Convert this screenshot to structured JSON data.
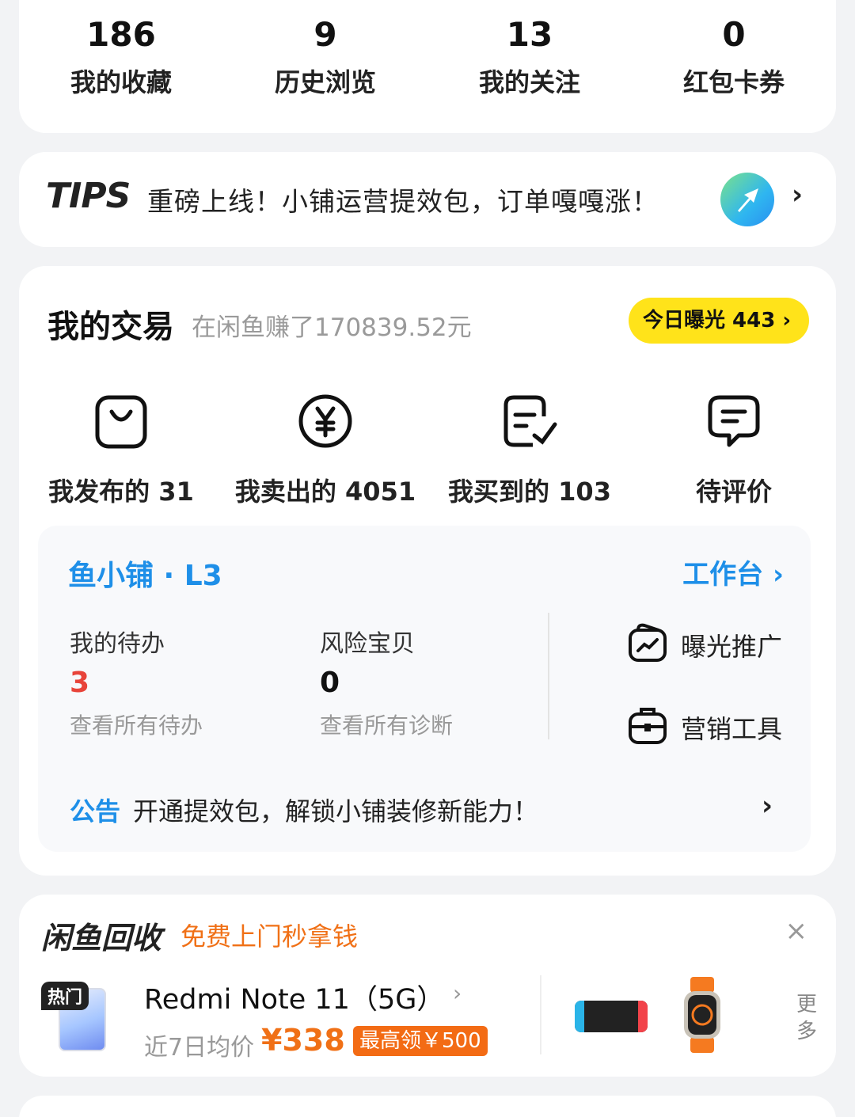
{
  "stats": [
    {
      "value": "186",
      "label": "我的收藏"
    },
    {
      "value": "9",
      "label": "历史浏览"
    },
    {
      "value": "13",
      "label": "我的关注"
    },
    {
      "value": "0",
      "label": "红包卡券"
    }
  ],
  "tips": {
    "logo": "TIPS",
    "text": "重磅上线！小铺运营提效包，订单嘎嘎涨！",
    "chevron": "›"
  },
  "trade": {
    "title": "我的交易",
    "earned": "在闲鱼赚了170839.52元",
    "exposure": "今日曝光 443 ›",
    "entries": [
      {
        "icon": "bag-icon",
        "label": "我发布的 31"
      },
      {
        "icon": "yen-circle-icon",
        "label": "我卖出的 4051"
      },
      {
        "icon": "checked-list-icon",
        "label": "我买到的 103"
      },
      {
        "icon": "comment-icon",
        "label": "待评价"
      }
    ],
    "shop": {
      "name": "鱼小铺 · L3",
      "workbench": "工作台 ›",
      "todo": {
        "title": "我的待办",
        "value": "3",
        "link": "查看所有待办"
      },
      "risk": {
        "title": "风险宝贝",
        "value": "0",
        "link": "查看所有诊断"
      },
      "tools": [
        {
          "icon": "chart-bag-icon",
          "label": "曝光推广"
        },
        {
          "icon": "briefcase-icon",
          "label": "营销工具"
        }
      ],
      "notice_tag": "公告",
      "notice_text": "开通提效包，解锁小铺装修新能力！",
      "notice_chevron": "›"
    }
  },
  "recycle": {
    "title": "闲鱼回收",
    "subtitle": "免费上门秒拿钱",
    "close": "×",
    "hot_badge": "热门",
    "product_name": "Redmi Note 11（5G）",
    "product_chevron": "›",
    "avg_label": "近7日均价",
    "price": "¥338",
    "max_tag": "最高领￥500",
    "more": "更多"
  },
  "colors": {
    "accent_blue": "#1e8fe8",
    "accent_orange": "#f07016",
    "highlight_yellow": "#ffe31a",
    "todo_red": "#e8443a"
  }
}
